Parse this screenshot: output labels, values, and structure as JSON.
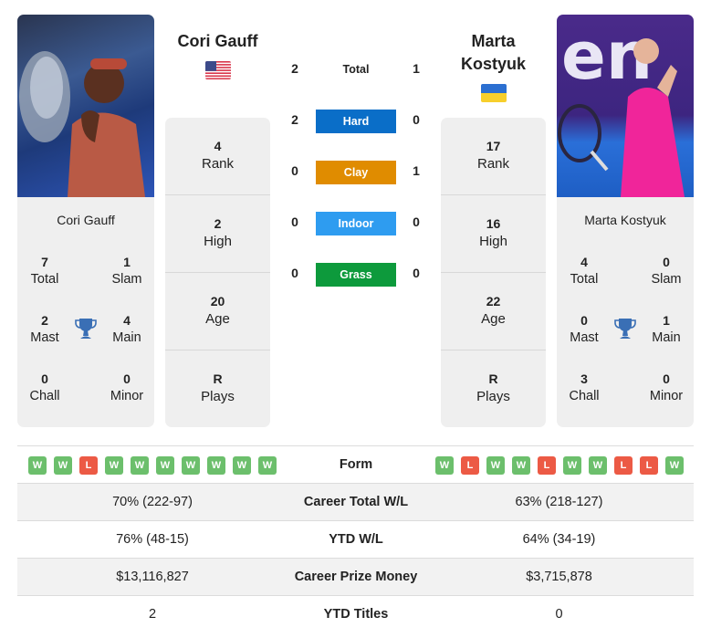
{
  "player1": {
    "name": "Cori Gauff",
    "card_name": "Cori Gauff",
    "country_flag": "usa-flag",
    "titles": {
      "total": {
        "value": "7",
        "label": "Total"
      },
      "slam": {
        "value": "1",
        "label": "Slam"
      },
      "mast": {
        "value": "2",
        "label": "Mast"
      },
      "main": {
        "value": "4",
        "label": "Main"
      },
      "chall": {
        "value": "0",
        "label": "Chall"
      },
      "minor": {
        "value": "0",
        "label": "Minor"
      }
    },
    "stats": [
      {
        "value": "4",
        "label": "Rank"
      },
      {
        "value": "2",
        "label": "High"
      },
      {
        "value": "20",
        "label": "Age"
      },
      {
        "value": "R",
        "label": "Plays"
      }
    ],
    "form": [
      "W",
      "W",
      "L",
      "W",
      "W",
      "W",
      "W",
      "W",
      "W",
      "W"
    ]
  },
  "player2": {
    "name_line1": "Marta",
    "name_line2": "Kostyuk",
    "card_name": "Marta Kostyuk",
    "country_flag": "ukraine-flag",
    "titles": {
      "total": {
        "value": "4",
        "label": "Total"
      },
      "slam": {
        "value": "0",
        "label": "Slam"
      },
      "mast": {
        "value": "0",
        "label": "Mast"
      },
      "main": {
        "value": "1",
        "label": "Main"
      },
      "chall": {
        "value": "3",
        "label": "Chall"
      },
      "minor": {
        "value": "0",
        "label": "Minor"
      }
    },
    "stats": [
      {
        "value": "17",
        "label": "Rank"
      },
      {
        "value": "16",
        "label": "High"
      },
      {
        "value": "22",
        "label": "Age"
      },
      {
        "value": "R",
        "label": "Plays"
      }
    ],
    "form": [
      "W",
      "L",
      "W",
      "W",
      "L",
      "W",
      "W",
      "L",
      "L",
      "W"
    ]
  },
  "h2h": [
    {
      "label": "Total",
      "p1": "2",
      "p2": "1",
      "color": ""
    },
    {
      "label": "Hard",
      "p1": "2",
      "p2": "0",
      "color": "#0a6ec8"
    },
    {
      "label": "Clay",
      "p1": "0",
      "p2": "1",
      "color": "#e08c00"
    },
    {
      "label": "Indoor",
      "p1": "0",
      "p2": "0",
      "color": "#2e9cf0"
    },
    {
      "label": "Grass",
      "p1": "0",
      "p2": "0",
      "color": "#0d9a3c"
    }
  ],
  "colors": {
    "win": "#6cbf6c",
    "loss": "#ec5a45",
    "trophy": "#3a6fb5"
  },
  "comparison": {
    "form_label": "Form",
    "rows": [
      {
        "label": "Career Total W/L",
        "p1": "70% (222-97)",
        "p2": "63% (218-127)"
      },
      {
        "label": "YTD W/L",
        "p1": "76% (48-15)",
        "p2": "64% (34-19)"
      },
      {
        "label": "Career Prize Money",
        "p1": "$13,116,827",
        "p2": "$3,715,878"
      },
      {
        "label": "YTD Titles",
        "p1": "2",
        "p2": "0"
      }
    ]
  }
}
